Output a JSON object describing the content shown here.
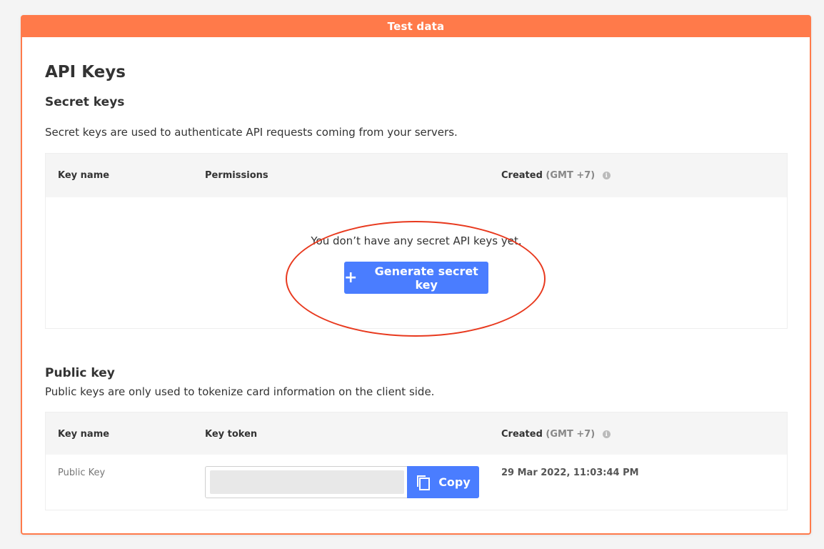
{
  "banner": {
    "label": "Test data"
  },
  "page": {
    "title": "API Keys"
  },
  "secret": {
    "heading": "Secret keys",
    "description": "Secret keys are used to authenticate API requests coming from your servers.",
    "columns": {
      "key_name": "Key name",
      "permissions": "Permissions",
      "created": "Created",
      "tz": "(GMT +7)"
    },
    "empty_text": "You don’t have any secret API keys yet.",
    "generate_label": "Generate secret key"
  },
  "public": {
    "heading": "Public key",
    "description": "Public keys are only used to tokenize card information on the client side.",
    "columns": {
      "key_name": "Key name",
      "key_token": "Key token",
      "created": "Created",
      "tz": "(GMT +7)"
    },
    "row": {
      "name": "Public Key",
      "created": "29 Mar 2022, 11:03:44 PM",
      "copy_label": "Copy"
    }
  },
  "colors": {
    "accent": "#ff7a4a",
    "primary": "#4a7dff",
    "highlight": "#e8391e"
  },
  "icons": {
    "info": "info-icon",
    "copy": "copy-icon",
    "plus": "plus-icon"
  }
}
